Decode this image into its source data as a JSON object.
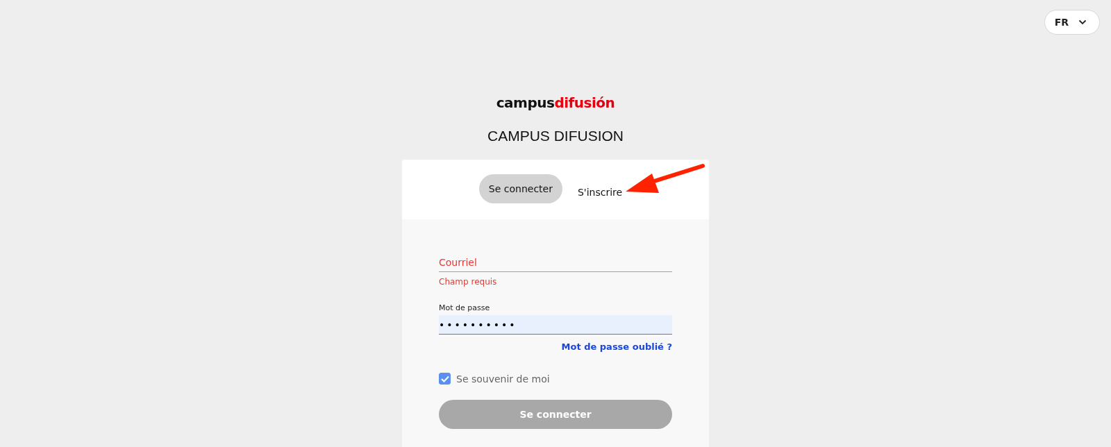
{
  "language_button": {
    "label": "FR"
  },
  "logo": {
    "part_1": "campus",
    "part_2": "difusión"
  },
  "title": "CAMPUS DIFUSION",
  "tabs": [
    {
      "label": "Se connecter",
      "selected": true
    },
    {
      "label": "S'inscrire",
      "selected": false
    }
  ],
  "email_field": {
    "placeholder": "Courriel",
    "invalid": true,
    "error": "Champ requis"
  },
  "password_field": {
    "label": "Mot de passe",
    "value": "••••••••••"
  },
  "forgot_link": "Mot de passe oublié ?",
  "remember_checkbox": {
    "label": "Se souvenir de moi",
    "checked": true
  },
  "submit_button": {
    "label": "Se connecter",
    "disabled": true
  }
}
